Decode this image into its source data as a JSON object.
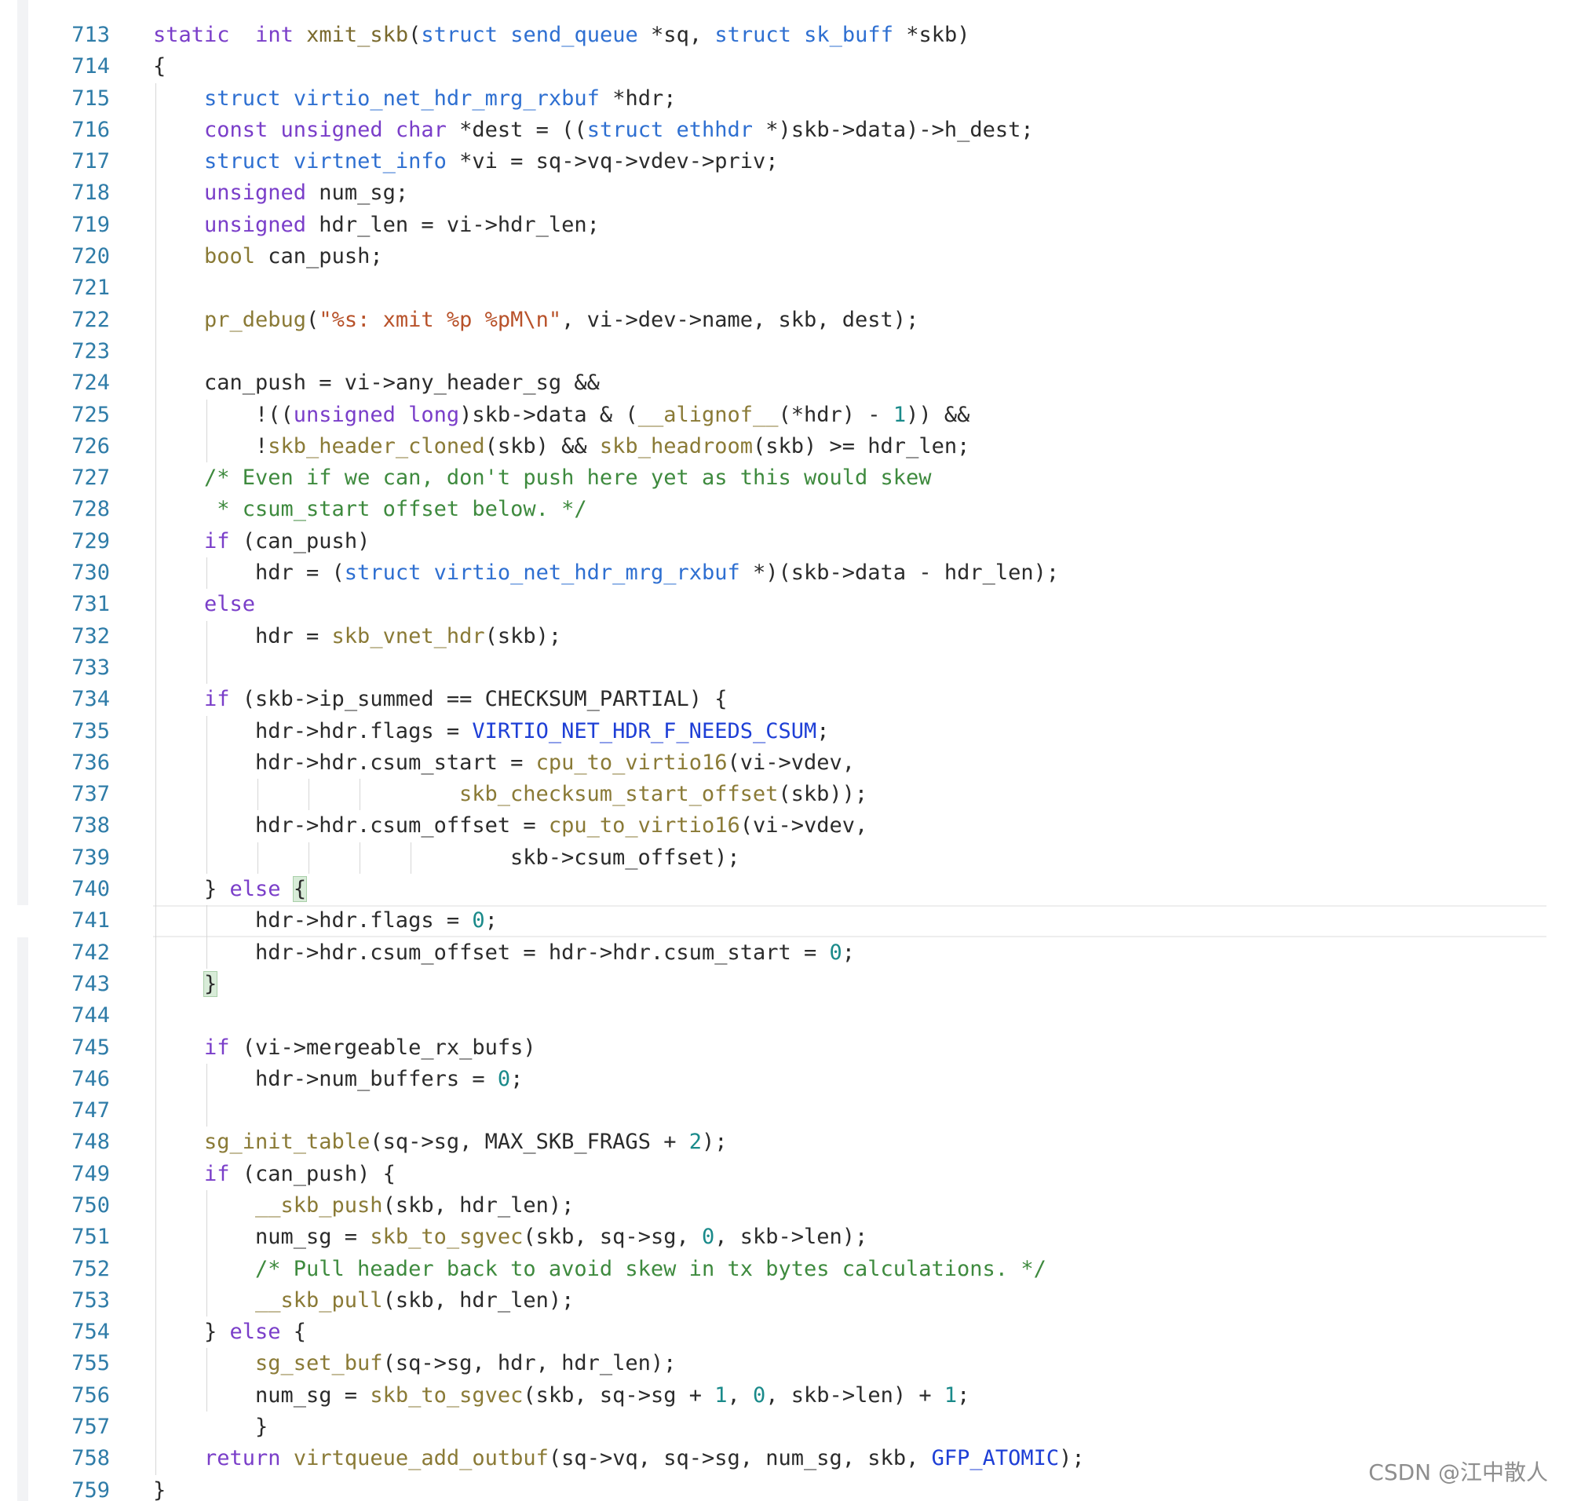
{
  "editor": {
    "lines": [
      {
        "num": "713",
        "indent": 0,
        "guides": 0,
        "tokens": [
          [
            "kw",
            "static"
          ],
          [
            "",
            "  "
          ],
          [
            "kw",
            "int"
          ],
          [
            "",
            ""
          ],
          [
            "fn",
            " xmit_skb"
          ],
          [
            "",
            "("
          ],
          [
            "ty",
            "struct"
          ],
          [
            "",
            " "
          ],
          [
            "ty",
            "send_queue"
          ],
          [
            "",
            " *sq, "
          ],
          [
            "ty",
            "struct"
          ],
          [
            "",
            " "
          ],
          [
            "ty",
            "sk_buff"
          ],
          [
            "",
            " *skb)"
          ]
        ]
      },
      {
        "num": "714",
        "indent": 0,
        "guides": 0,
        "tokens": [
          [
            "",
            "{"
          ]
        ]
      },
      {
        "num": "715",
        "indent": 1,
        "guides": 1,
        "tokens": [
          [
            "ty",
            "struct"
          ],
          [
            "",
            " "
          ],
          [
            "ty",
            "virtio_net_hdr_mrg_rxbuf"
          ],
          [
            "",
            " *hdr;"
          ]
        ]
      },
      {
        "num": "716",
        "indent": 1,
        "guides": 1,
        "tokens": [
          [
            "kw",
            "const"
          ],
          [
            "",
            " "
          ],
          [
            "kw",
            "unsigned char"
          ],
          [
            "",
            " *dest = (("
          ],
          [
            "ty",
            "struct"
          ],
          [
            "",
            " "
          ],
          [
            "ty",
            "ethhdr"
          ],
          [
            "",
            " *)skb->data)->h_dest;"
          ]
        ]
      },
      {
        "num": "717",
        "indent": 1,
        "guides": 1,
        "tokens": [
          [
            "ty",
            "struct"
          ],
          [
            "",
            " "
          ],
          [
            "ty",
            "virtnet_info"
          ],
          [
            "",
            " *vi = sq->vq->vdev->priv;"
          ]
        ]
      },
      {
        "num": "718",
        "indent": 1,
        "guides": 1,
        "tokens": [
          [
            "kw",
            "unsigned"
          ],
          [
            "",
            " num_sg;"
          ]
        ]
      },
      {
        "num": "719",
        "indent": 1,
        "guides": 1,
        "tokens": [
          [
            "kw",
            "unsigned"
          ],
          [
            "",
            " hdr_len = vi->hdr_len;"
          ]
        ]
      },
      {
        "num": "720",
        "indent": 1,
        "guides": 1,
        "tokens": [
          [
            "fnc",
            "bool"
          ],
          [
            "",
            " can_push;"
          ]
        ]
      },
      {
        "num": "721",
        "indent": 0,
        "guides": 1,
        "tokens": []
      },
      {
        "num": "722",
        "indent": 1,
        "guides": 1,
        "tokens": [
          [
            "fnc",
            "pr_debug"
          ],
          [
            "",
            "("
          ],
          [
            "str",
            "\"%s: xmit %p %pM\\n\""
          ],
          [
            "",
            ", vi->dev->name, skb, dest);"
          ]
        ]
      },
      {
        "num": "723",
        "indent": 0,
        "guides": 1,
        "tokens": []
      },
      {
        "num": "724",
        "indent": 1,
        "guides": 1,
        "tokens": [
          [
            "",
            "can_push = vi->any_header_sg &&"
          ]
        ]
      },
      {
        "num": "725",
        "indent": 2,
        "guides": 2,
        "tokens": [
          [
            "",
            "!(("
          ],
          [
            "kw",
            "unsigned long"
          ],
          [
            "",
            ")skb->data & ("
          ],
          [
            "fnc",
            "__alignof__"
          ],
          [
            "",
            "(*hdr) - "
          ],
          [
            "num",
            "1"
          ],
          [
            "",
            "))"
          ],
          [
            "",
            " &&"
          ]
        ]
      },
      {
        "num": "726",
        "indent": 2,
        "guides": 2,
        "tokens": [
          [
            "",
            "!"
          ],
          [
            "fnc",
            "skb_header_cloned"
          ],
          [
            "",
            "(skb) && "
          ],
          [
            "fnc",
            "skb_headroom"
          ],
          [
            "",
            "(skb) >= hdr_len;"
          ]
        ]
      },
      {
        "num": "727",
        "indent": 1,
        "guides": 1,
        "tokens": [
          [
            "cmt",
            "/* Even if we can, don't push here yet as this would skew"
          ]
        ]
      },
      {
        "num": "728",
        "indent": 1,
        "guides": 1,
        "tokens": [
          [
            "cmt",
            " * csum_start offset below. */"
          ]
        ]
      },
      {
        "num": "729",
        "indent": 1,
        "guides": 1,
        "tokens": [
          [
            "kw",
            "if"
          ],
          [
            "",
            " (can_push)"
          ]
        ]
      },
      {
        "num": "730",
        "indent": 2,
        "guides": 2,
        "tokens": [
          [
            "",
            "hdr = ("
          ],
          [
            "ty",
            "struct"
          ],
          [
            "",
            " "
          ],
          [
            "ty",
            "virtio_net_hdr_mrg_rxbuf"
          ],
          [
            "",
            " *)(skb->data - hdr_len);"
          ]
        ]
      },
      {
        "num": "731",
        "indent": 1,
        "guides": 1,
        "tokens": [
          [
            "kw",
            "else"
          ]
        ]
      },
      {
        "num": "732",
        "indent": 2,
        "guides": 2,
        "tokens": [
          [
            "",
            "hdr = "
          ],
          [
            "fnc",
            "skb_vnet_hdr"
          ],
          [
            "",
            "(skb);"
          ]
        ]
      },
      {
        "num": "733",
        "indent": 0,
        "guides": 2,
        "tokens": []
      },
      {
        "num": "734",
        "indent": 1,
        "guides": 1,
        "tokens": [
          [
            "kw",
            "if"
          ],
          [
            "",
            " (skb->ip_summed == CHECKSUM_PARTIAL) {"
          ]
        ]
      },
      {
        "num": "735",
        "indent": 2,
        "guides": 2,
        "tokens": [
          [
            "",
            "hdr->hdr.flags = "
          ],
          [
            "mac",
            "VIRTIO_NET_HDR_F_NEEDS_CSUM"
          ],
          [
            "",
            ";"
          ]
        ]
      },
      {
        "num": "736",
        "indent": 2,
        "guides": 2,
        "tokens": [
          [
            "",
            "hdr->hdr.csum_start = "
          ],
          [
            "fnc",
            "cpu_to_virtio16"
          ],
          [
            "",
            "(vi->vdev,"
          ]
        ]
      },
      {
        "num": "737",
        "indent": 6,
        "guides": 5,
        "tokens": [
          [
            "fnc",
            "skb_checksum_start_offset"
          ],
          [
            "",
            "(skb));"
          ]
        ]
      },
      {
        "num": "738",
        "indent": 2,
        "guides": 2,
        "tokens": [
          [
            "",
            "hdr->hdr.csum_offset = "
          ],
          [
            "fnc",
            "cpu_to_virtio16"
          ],
          [
            "",
            "(vi->vdev,"
          ]
        ]
      },
      {
        "num": "739",
        "indent": 7,
        "guides": 6,
        "tokens": [
          [
            "",
            "skb->csum_offset);"
          ]
        ]
      },
      {
        "num": "740",
        "indent": 1,
        "guides": 1,
        "tokens": [
          [
            "",
            "} "
          ],
          [
            "kw",
            "else"
          ],
          [
            "",
            " "
          ],
          [
            "brace",
            "{"
          ]
        ]
      },
      {
        "num": "741",
        "indent": 2,
        "guides": 2,
        "current": true,
        "tokens": [
          [
            "",
            "hdr->hdr.flags = "
          ],
          [
            "num",
            "0"
          ],
          [
            "",
            ";"
          ]
        ]
      },
      {
        "num": "742",
        "indent": 2,
        "guides": 2,
        "tokens": [
          [
            "",
            "hdr->hdr.csum_offset = hdr->hdr.csum_start = "
          ],
          [
            "num",
            "0"
          ],
          [
            "",
            ";"
          ]
        ]
      },
      {
        "num": "743",
        "indent": 1,
        "guides": 1,
        "tokens": [
          [
            "brace",
            "}"
          ]
        ]
      },
      {
        "num": "744",
        "indent": 0,
        "guides": 1,
        "tokens": []
      },
      {
        "num": "745",
        "indent": 1,
        "guides": 1,
        "tokens": [
          [
            "kw",
            "if"
          ],
          [
            "",
            " (vi->mergeable_rx_bufs)"
          ]
        ]
      },
      {
        "num": "746",
        "indent": 2,
        "guides": 2,
        "tokens": [
          [
            "",
            "hdr->num_buffers = "
          ],
          [
            "num",
            "0"
          ],
          [
            "",
            ";"
          ]
        ]
      },
      {
        "num": "747",
        "indent": 0,
        "guides": 2,
        "tokens": []
      },
      {
        "num": "748",
        "indent": 1,
        "guides": 1,
        "tokens": [
          [
            "fnc",
            "sg_init_table"
          ],
          [
            "",
            "(sq->sg, MAX_SKB_FRAGS + "
          ],
          [
            "num",
            "2"
          ],
          [
            "",
            ");"
          ]
        ]
      },
      {
        "num": "749",
        "indent": 1,
        "guides": 1,
        "tokens": [
          [
            "kw",
            "if"
          ],
          [
            "",
            " (can_push) {"
          ]
        ]
      },
      {
        "num": "750",
        "indent": 2,
        "guides": 2,
        "tokens": [
          [
            "fnc",
            "__skb_push"
          ],
          [
            "",
            "(skb, hdr_len);"
          ]
        ]
      },
      {
        "num": "751",
        "indent": 2,
        "guides": 2,
        "tokens": [
          [
            "",
            "num_sg = "
          ],
          [
            "fnc",
            "skb_to_sgvec"
          ],
          [
            "",
            "(skb, sq->sg, "
          ],
          [
            "num",
            "0"
          ],
          [
            "",
            ", skb->len);"
          ]
        ]
      },
      {
        "num": "752",
        "indent": 2,
        "guides": 2,
        "tokens": [
          [
            "cmt",
            "/* Pull header back to avoid skew in tx bytes calculations. */"
          ]
        ]
      },
      {
        "num": "753",
        "indent": 2,
        "guides": 2,
        "tokens": [
          [
            "fnc",
            "__skb_pull"
          ],
          [
            "",
            "(skb, hdr_len);"
          ]
        ]
      },
      {
        "num": "754",
        "indent": 1,
        "guides": 1,
        "tokens": [
          [
            "",
            "} "
          ],
          [
            "kw",
            "else"
          ],
          [
            "",
            " {"
          ]
        ]
      },
      {
        "num": "755",
        "indent": 2,
        "guides": 2,
        "tokens": [
          [
            "fnc",
            "sg_set_buf"
          ],
          [
            "",
            "(sq->sg, hdr, hdr_len);"
          ]
        ]
      },
      {
        "num": "756",
        "indent": 2,
        "guides": 2,
        "tokens": [
          [
            "",
            "num_sg = "
          ],
          [
            "fnc",
            "skb_to_sgvec"
          ],
          [
            "",
            "(skb, sq->sg + "
          ],
          [
            "num",
            "1"
          ],
          [
            "",
            ", "
          ],
          [
            "num",
            "0"
          ],
          [
            "",
            ", skb->len) + "
          ],
          [
            "num",
            "1"
          ],
          [
            "",
            ";"
          ]
        ]
      },
      {
        "num": "757",
        "indent": 2,
        "guides": 1,
        "tokens": [
          [
            "",
            "}"
          ]
        ]
      },
      {
        "num": "758",
        "indent": 1,
        "guides": 1,
        "tokens": [
          [
            "kw",
            "return"
          ],
          [
            "",
            " "
          ],
          [
            "fnc",
            "virtqueue_add_outbuf"
          ],
          [
            "",
            "(sq->vq, sq->sg, num_sg, skb, "
          ],
          [
            "mac",
            "GFP_ATOMIC"
          ],
          [
            "",
            ");"
          ]
        ]
      },
      {
        "num": "759",
        "indent": 0,
        "guides": 0,
        "tokens": [
          [
            "",
            "}"
          ]
        ]
      }
    ]
  },
  "watermark": "CSDN @江中散人"
}
